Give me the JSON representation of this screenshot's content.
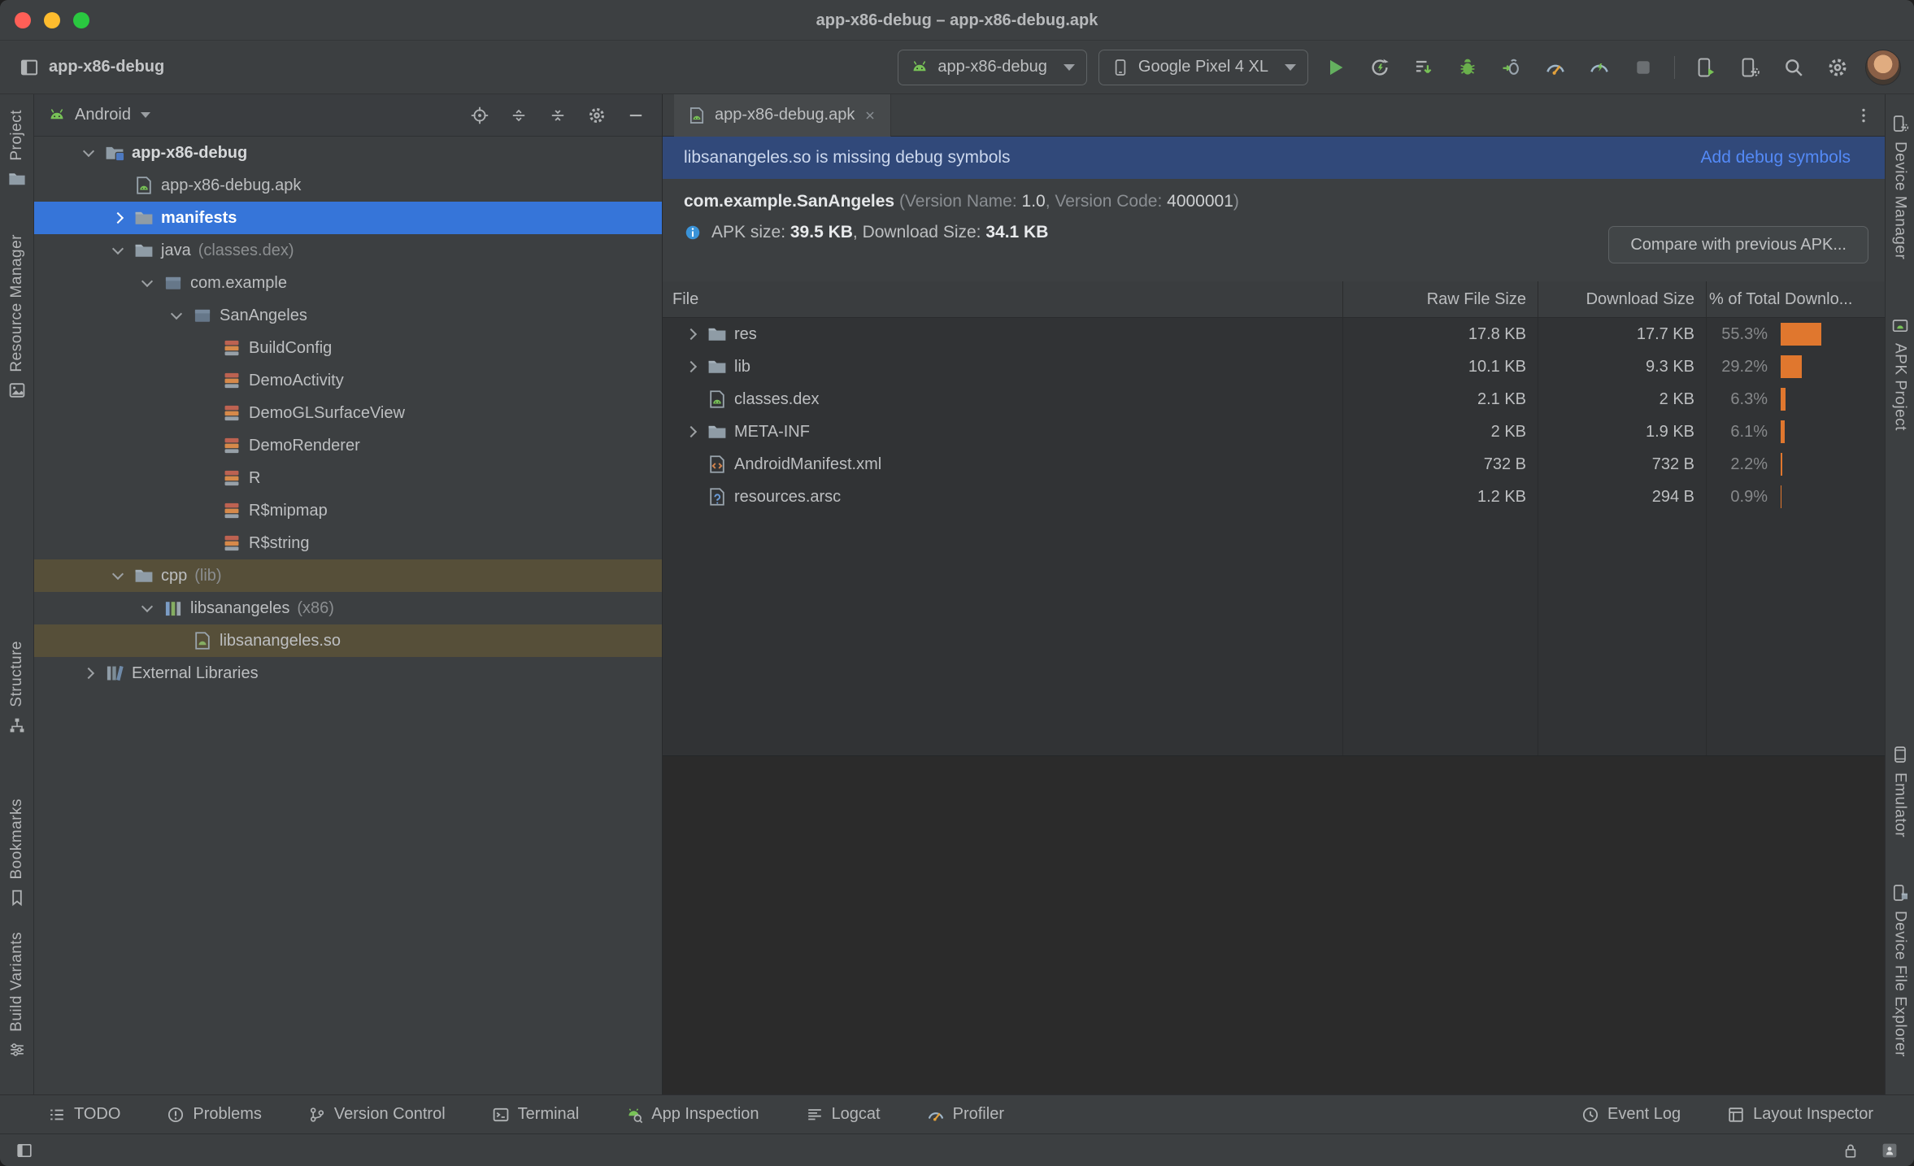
{
  "window": {
    "title": "app-x86-debug – app-x86-debug.apk"
  },
  "colors": {
    "selection_blue": "#3675d9",
    "warning_row_olive": "#564f39",
    "banner_blue": "#31497a",
    "link_blue": "#548af7",
    "bar_orange": "#e0772e",
    "run_green": "#64b05f"
  },
  "toolbar": {
    "project_name": "app-x86-debug",
    "run_config_label": "app-x86-debug",
    "device_label": "Google Pixel 4 XL",
    "actions": [
      {
        "name": "run-button",
        "icon": "run"
      },
      {
        "name": "apply-changes-button",
        "icon": "rerun"
      },
      {
        "name": "apply-code-changes-button",
        "icon": "apply"
      },
      {
        "name": "debug-button",
        "icon": "bug"
      },
      {
        "name": "attach-debugger-button",
        "icon": "attach"
      },
      {
        "name": "profile-button",
        "icon": "gauge"
      },
      {
        "name": "profile-low-overhead-button",
        "icon": "gauge-green"
      },
      {
        "name": "stop-button",
        "icon": "stop"
      }
    ],
    "device_actions": [
      {
        "name": "running-devices-button",
        "icon": "phone-play"
      },
      {
        "name": "device-manager-button",
        "icon": "devicemgr"
      }
    ]
  },
  "left_stripe": [
    {
      "label": "Project",
      "icon": "folder",
      "name": "tool-project"
    },
    {
      "label": "Resource Manager",
      "icon": "resource",
      "name": "tool-resource-manager"
    },
    {
      "label": "Structure",
      "icon": "structure",
      "name": "tool-structure"
    },
    {
      "label": "Bookmarks",
      "icon": "bookmarks",
      "name": "tool-bookmarks"
    },
    {
      "label": "Build Variants",
      "icon": "variants",
      "name": "tool-build-variants"
    }
  ],
  "right_stripe": [
    {
      "label": "Device Manager",
      "icon": "devicemgr",
      "name": "tool-device-manager"
    },
    {
      "label": "APK Project",
      "icon": "apkbox",
      "name": "tool-apk-project"
    },
    {
      "label": "Emulator",
      "icon": "emulator",
      "name": "tool-emulator"
    },
    {
      "label": "Device File Explorer",
      "icon": "devexplorer",
      "name": "tool-device-file-explorer"
    }
  ],
  "project_panel": {
    "selector_label": "Android",
    "tree": [
      {
        "label": "app-x86-debug",
        "level": 0,
        "icon": "folder-app",
        "chevron": "expanded",
        "state": "root"
      },
      {
        "label": "app-x86-debug.apk",
        "level": 1,
        "icon": "apk",
        "chevron": "",
        "state": ""
      },
      {
        "label": "manifests",
        "level": 1,
        "icon": "folder",
        "chevron": "collapsed",
        "state": "selected"
      },
      {
        "label": "java",
        "annotation": "(classes.dex)",
        "level": 1,
        "icon": "folder",
        "chevron": "expanded",
        "state": ""
      },
      {
        "label": "com.example",
        "level": 2,
        "icon": "package",
        "chevron": "expanded",
        "state": ""
      },
      {
        "label": "SanAngeles",
        "level": 3,
        "icon": "package",
        "chevron": "expanded",
        "state": ""
      },
      {
        "label": "BuildConfig",
        "level": 4,
        "icon": "class",
        "chevron": "",
        "state": ""
      },
      {
        "label": "DemoActivity",
        "level": 4,
        "icon": "class",
        "chevron": "",
        "state": ""
      },
      {
        "label": "DemoGLSurfaceView",
        "level": 4,
        "icon": "class",
        "chevron": "",
        "state": ""
      },
      {
        "label": "DemoRenderer",
        "level": 4,
        "icon": "class",
        "chevron": "",
        "state": ""
      },
      {
        "label": "R",
        "level": 4,
        "icon": "class",
        "chevron": "",
        "state": ""
      },
      {
        "label": "R$mipmap",
        "level": 4,
        "icon": "class",
        "chevron": "",
        "state": ""
      },
      {
        "label": "R$string",
        "level": 4,
        "icon": "class",
        "chevron": "",
        "state": ""
      },
      {
        "label": "cpp",
        "annotation": "(lib)",
        "level": 1,
        "icon": "folder",
        "chevron": "expanded",
        "state": "warning"
      },
      {
        "label": "libsanangeles",
        "annotation": "(x86)",
        "level": 2,
        "icon": "lib",
        "chevron": "expanded",
        "state": ""
      },
      {
        "label": "libsanangeles.so",
        "level": 3,
        "icon": "so",
        "chevron": "",
        "state": "warning"
      },
      {
        "label": "External Libraries",
        "level": 0,
        "icon": "extlib",
        "chevron": "collapsed",
        "state": ""
      }
    ]
  },
  "editor": {
    "tab_label": "app-x86-debug.apk",
    "banner_message": "libsanangeles.so is missing debug symbols",
    "banner_action": "Add debug symbols",
    "package_line": {
      "name": "com.example.SanAngeles",
      "pre": " (Version Name: ",
      "version_name": "1.0",
      "mid": ", Version Code: ",
      "version_code": "4000001",
      "post": ")"
    },
    "size_line": {
      "pre": "APK size: ",
      "apk_size": "39.5 KB",
      "mid": ", Download Size: ",
      "download_size": "34.1 KB"
    },
    "compare_button": "Compare with previous APK...",
    "table": {
      "columns": [
        "File",
        "Raw File Size",
        "Download Size",
        "% of Total Downlo..."
      ],
      "rows": [
        {
          "name": "res",
          "icon": "folder",
          "chevron": "collapsed",
          "raw": "17.8 KB",
          "download": "17.7 KB",
          "pct": "55.3%",
          "pct_value": 55.3
        },
        {
          "name": "lib",
          "icon": "folder",
          "chevron": "collapsed",
          "raw": "10.1 KB",
          "download": "9.3 KB",
          "pct": "29.2%",
          "pct_value": 29.2
        },
        {
          "name": "classes.dex",
          "icon": "apk",
          "chevron": "",
          "raw": "2.1 KB",
          "download": "2 KB",
          "pct": "6.3%",
          "pct_value": 6.3
        },
        {
          "name": "META-INF",
          "icon": "folder",
          "chevron": "collapsed",
          "raw": "2 KB",
          "download": "1.9 KB",
          "pct": "6.1%",
          "pct_value": 6.1
        },
        {
          "name": "AndroidManifest.xml",
          "icon": "xml",
          "chevron": "",
          "raw": "732 B",
          "download": "732 B",
          "pct": "2.2%",
          "pct_value": 2.2
        },
        {
          "name": "resources.arsc",
          "icon": "arsc",
          "chevron": "",
          "raw": "1.2 KB",
          "download": "294 B",
          "pct": "0.9%",
          "pct_value": 0.9
        }
      ]
    }
  },
  "bottom_bar": {
    "left": [
      {
        "label": "TODO",
        "icon": "todo",
        "name": "tool-todo"
      },
      {
        "label": "Problems",
        "icon": "problems",
        "name": "tool-problems"
      },
      {
        "label": "Version Control",
        "icon": "vcs",
        "name": "tool-version-control"
      },
      {
        "label": "Terminal",
        "icon": "terminal",
        "name": "tool-terminal"
      },
      {
        "label": "App Inspection",
        "icon": "inspection",
        "name": "tool-app-inspection"
      },
      {
        "label": "Logcat",
        "icon": "logcat",
        "name": "tool-logcat"
      },
      {
        "label": "Profiler",
        "icon": "gauge",
        "name": "tool-profiler"
      }
    ],
    "right": [
      {
        "label": "Event Log",
        "icon": "eventlog",
        "name": "tool-event-log"
      },
      {
        "label": "Layout Inspector",
        "icon": "layoutinspector",
        "name": "tool-layout-inspector"
      }
    ]
  }
}
